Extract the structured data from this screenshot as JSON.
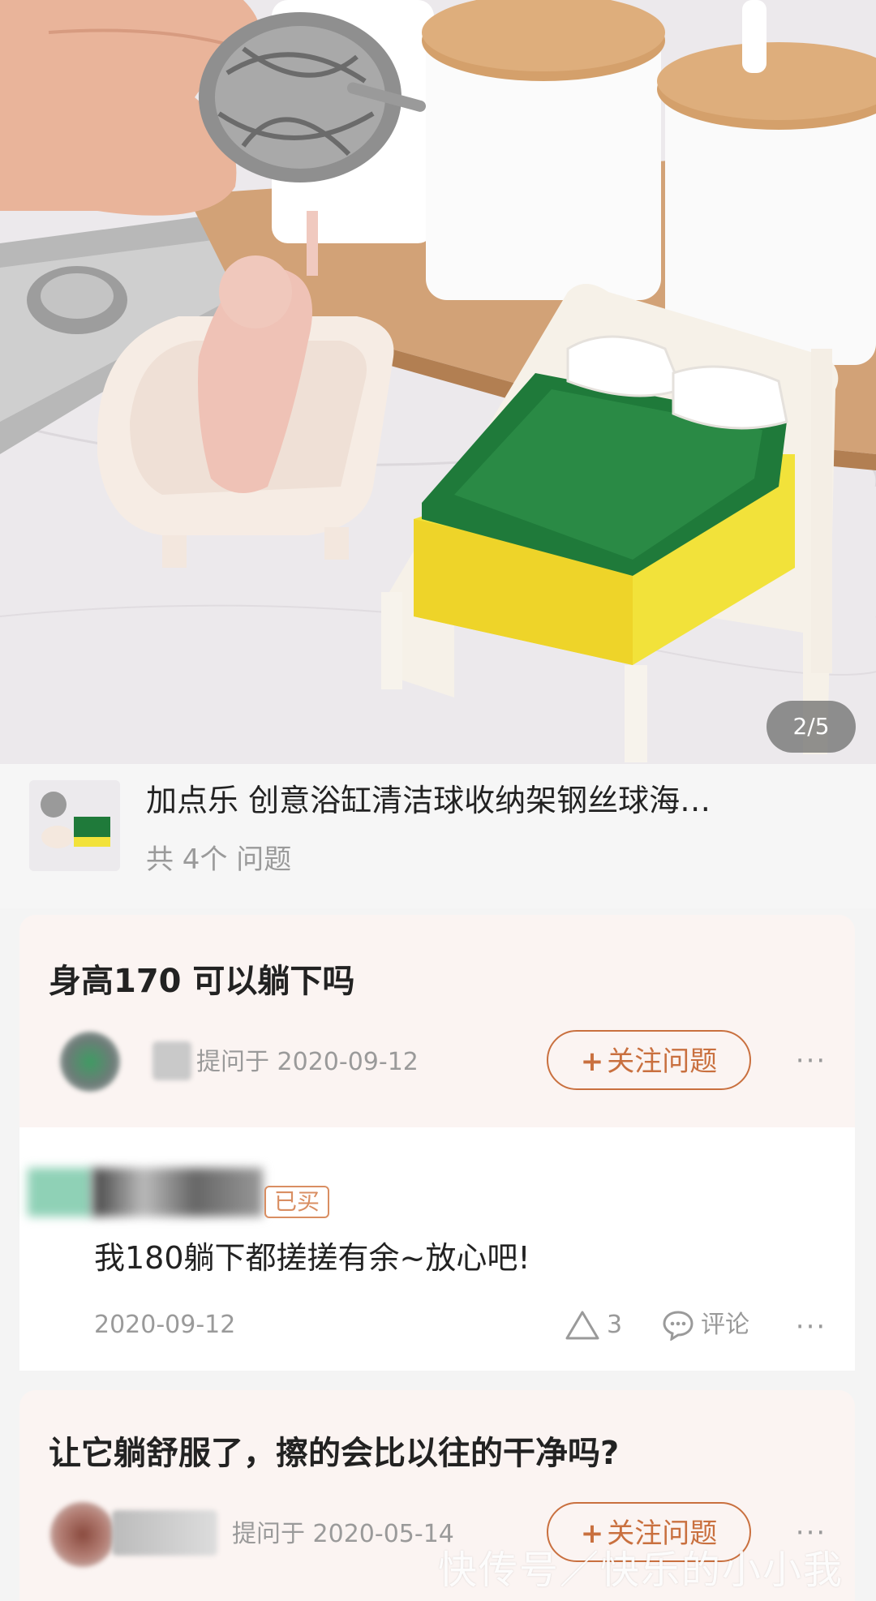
{
  "gallery": {
    "page_indicator": "2/5"
  },
  "product": {
    "title": "加点乐 创意浴缸清洁球收纳架钢丝球海…",
    "question_count": "共 4个 问题"
  },
  "questions": [
    {
      "title": "身高170 可以躺下吗",
      "asked_at": "提问于 2020-09-12",
      "follow_label": "关注问题",
      "more": "···"
    },
    {
      "title": "让它躺舒服了，擦的会比以往的干净吗?",
      "asked_at": "提问于 2020-05-14",
      "follow_label": "关注问题",
      "more": "···"
    }
  ],
  "answer": {
    "badge": "已买",
    "text": "我180躺下都搓搓有余~放心吧!",
    "date": "2020-09-12",
    "likes": "3",
    "comment_label": "评论",
    "more": "···"
  },
  "watermark": "快传号／快乐的小小我",
  "colors": {
    "accent": "#c9703f",
    "card_bg": "#fbf4f2",
    "sponge_green": "#1f7a3a",
    "sponge_yellow": "#f2e23a"
  }
}
